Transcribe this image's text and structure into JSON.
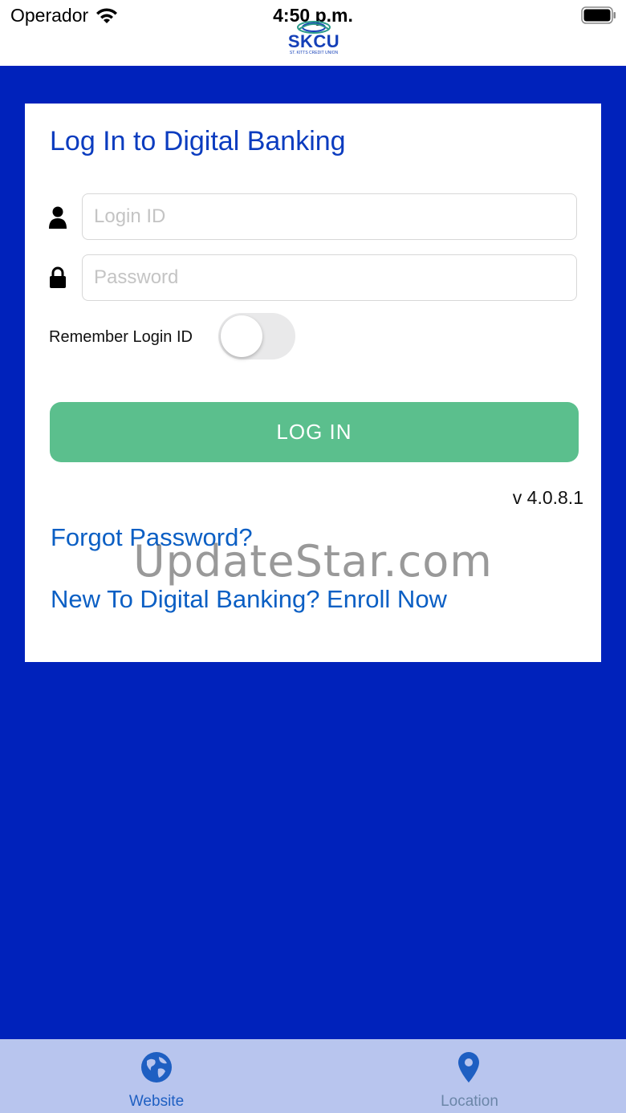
{
  "status_bar": {
    "carrier": "Operador",
    "time": "4:50 p.m."
  },
  "logo": {
    "name": "SKCU",
    "subtitle": "ST. KITTS CREDIT UNION"
  },
  "login_card": {
    "title": "Log In to Digital Banking",
    "login_id": {
      "placeholder": "Login ID",
      "value": "",
      "icon": "user-icon"
    },
    "password": {
      "placeholder": "Password",
      "value": "",
      "icon": "lock-icon"
    },
    "remember_label": "Remember Login ID",
    "remember_on": false,
    "login_button": "LOG IN",
    "version": "v 4.0.8.1",
    "forgot_password": "Forgot Password?",
    "enroll": "New To Digital Banking? Enroll Now"
  },
  "watermark": "UpdateStar.com",
  "tab_bar": {
    "tabs": [
      {
        "label": "Website",
        "icon": "globe-icon",
        "active": true
      },
      {
        "label": "Location",
        "icon": "location-pin-icon",
        "active": false
      }
    ]
  },
  "colors": {
    "background": "#0022bb",
    "title": "#0b3cbf",
    "link": "#0b5fc4",
    "login_button": "#5bbf8d",
    "tab_bar": "#b8c5ee",
    "tab_active": "#1e5fc2",
    "tab_inactive": "#6b86a8"
  }
}
